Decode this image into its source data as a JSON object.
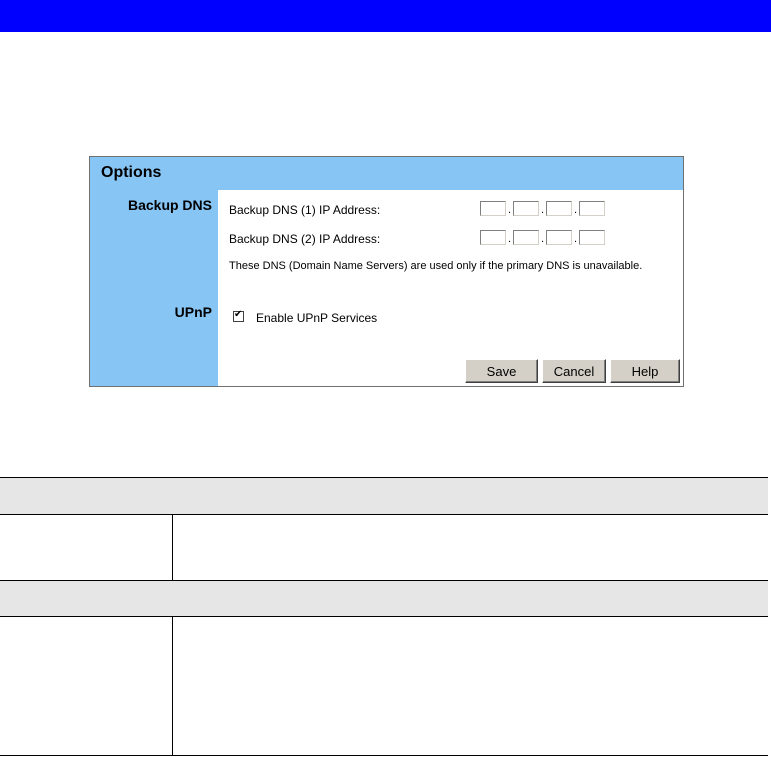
{
  "panel": {
    "title": "Options",
    "sections": {
      "backup_dns": "Backup DNS",
      "upnp": "UPnP"
    },
    "dns1_label": "Backup DNS (1) IP Address:",
    "dns2_label": "Backup DNS (2) IP Address:",
    "ip_separator": ".",
    "dns1_octets": [
      "",
      "",
      "",
      ""
    ],
    "dns2_octets": [
      "",
      "",
      "",
      ""
    ],
    "note": "These DNS (Domain Name Servers) are used only if the primary DNS is unavailable.",
    "upnp_checkbox_label": "Enable UPnP Services",
    "upnp_checked": true,
    "checkbox_mark": "✔",
    "buttons": {
      "save": "Save",
      "cancel": "Cancel",
      "help": "Help"
    }
  },
  "colors": {
    "top_bar": "#0000ff",
    "panel_accent": "#87c5f5",
    "table_header": "#e6e6e6"
  }
}
